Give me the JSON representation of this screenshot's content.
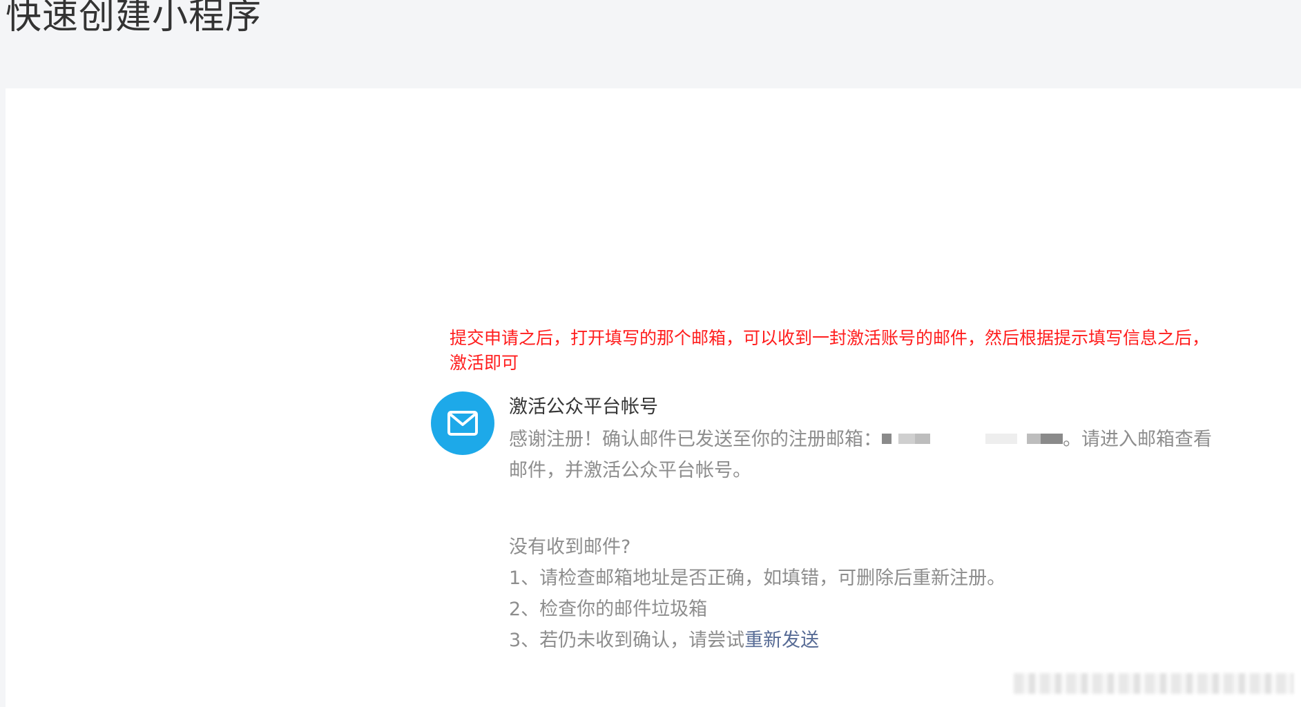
{
  "page": {
    "title": "快速创建小程序"
  },
  "annotation": {
    "line1": "提交申请之后，打开填写的那个邮箱，可以收到一封激活账号的邮件，然后根据提示填写信息之后，",
    "line2": "激活即可"
  },
  "card": {
    "icon": "mail-icon",
    "title": "激活公众平台帐号",
    "desc_prefix": "感谢注册！确认邮件已发送至你的注册邮箱：",
    "desc_suffix": "。请进入邮箱查看",
    "desc_line2": "邮件，并激活公众平台帐号。"
  },
  "help": {
    "heading": "没有收到邮件?",
    "item1": "1、请检查邮箱地址是否正确，如填错，可删除后重新注册。",
    "item2": "2、检查你的邮件垃圾箱",
    "item3_prefix": "3、若仍未收到确认，请尝试",
    "resend_label": "重新发送"
  },
  "colors": {
    "accent": "#1da9e9",
    "annotation": "#ff1d1d",
    "link": "#576b95",
    "muted_text": "#8d8d8d",
    "page_bg": "#f4f5f7"
  }
}
